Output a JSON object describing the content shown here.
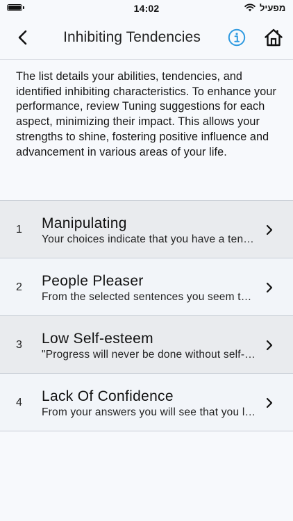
{
  "status_bar": {
    "time": "14:02",
    "carrier": "מפעיל"
  },
  "nav": {
    "title": "Inhibiting Tendencies",
    "icons": {
      "back": "chevron-left-icon",
      "info": "info-circle-icon",
      "home": "home-icon"
    },
    "accent_color": "#2f9ae0"
  },
  "intro_text": "The list details your abilities, tendencies, and identified inhibiting characteristics. To enhance your performance, review Tuning suggestions for each aspect, minimizing their impact. This allows your strengths to shine, fostering positive influence and advancement in various areas of your life.",
  "items": [
    {
      "number": "1",
      "title": "Manipulating",
      "subtitle": "Your choices indicate that you have a tendency to manipulate"
    },
    {
      "number": "2",
      "title": "People Pleaser",
      "subtitle": "From the selected sentences you seem to want to please others"
    },
    {
      "number": "3",
      "title": "Low Self-esteem",
      "subtitle": "\"Progress will never be done without self-esteem\""
    },
    {
      "number": "4",
      "title": "Lack Of Confidence",
      "subtitle": "From your answers you will see that you lack confidence"
    }
  ]
}
